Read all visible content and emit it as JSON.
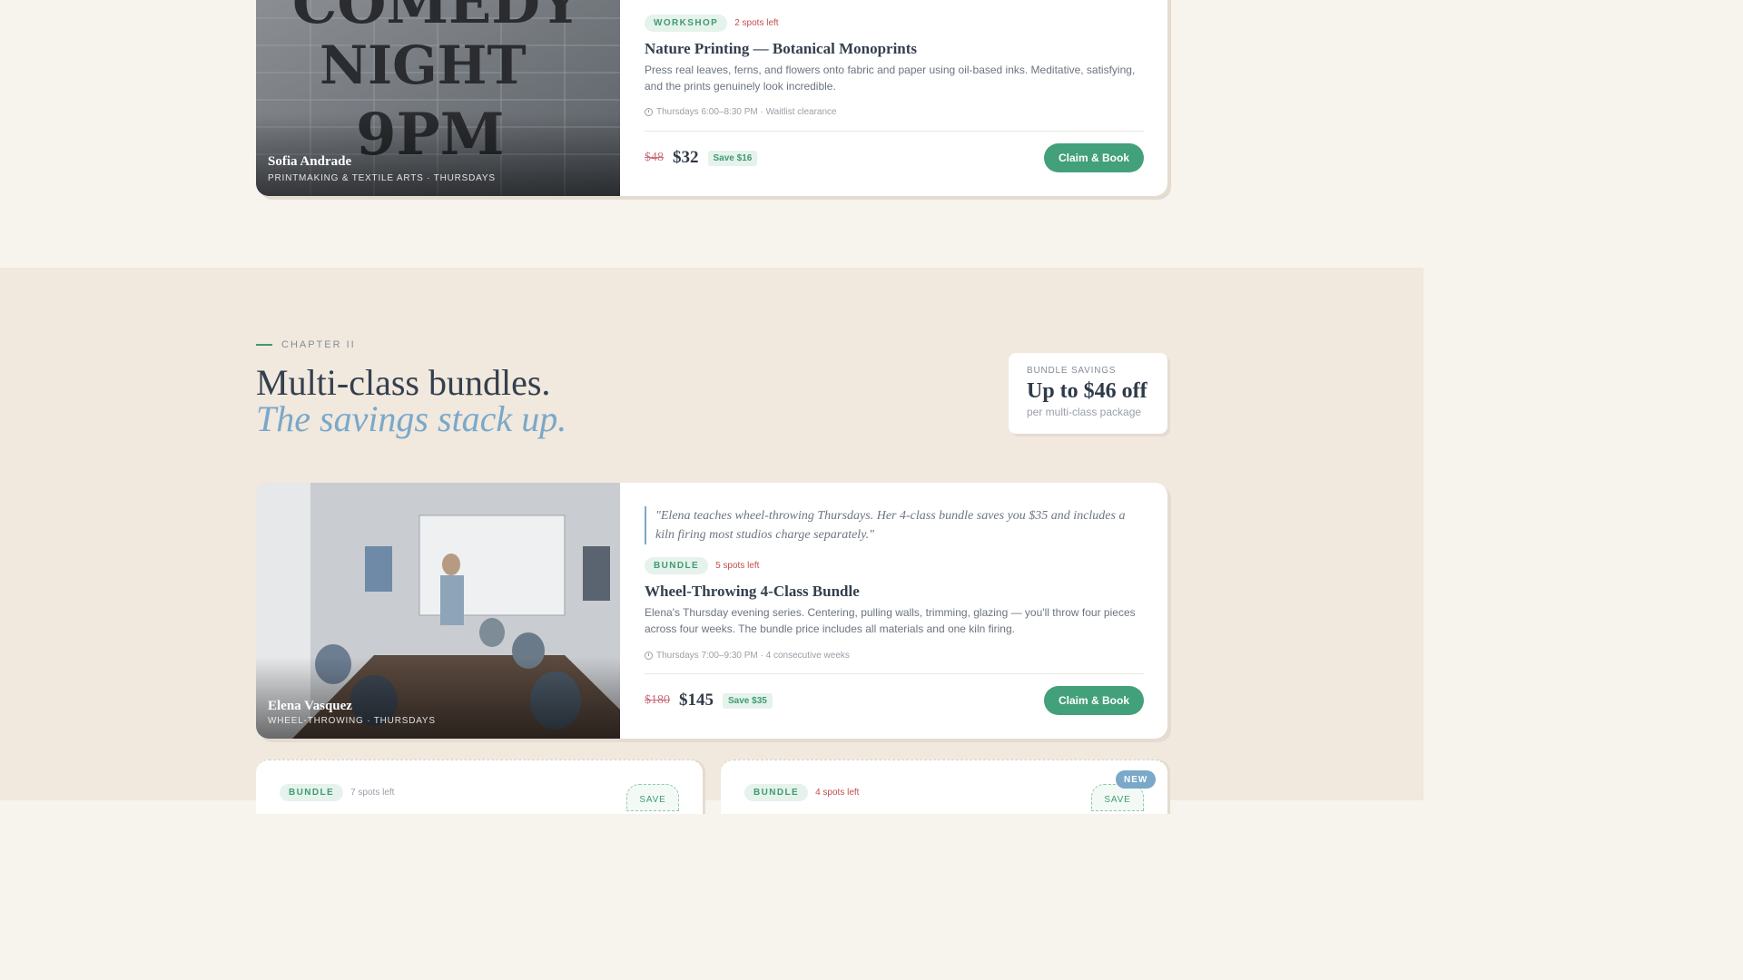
{
  "card1": {
    "instructor": {
      "name": "Sofia Andrade",
      "subtitle": "PRINTMAKING & TEXTILE ARTS · THURSDAYS"
    },
    "tag": "WORKSHOP",
    "spots": "2 spots left",
    "title": "Nature Printing — Botanical Monoprints",
    "description": "Press real leaves, ferns, and flowers onto fabric and paper using oil-based inks. Meditative, satisfying, and the prints genuinely look incredible.",
    "meta": "Thursdays 6:00–8:30 PM · Waitlist clearance",
    "old_price": "$48",
    "new_price": "$32",
    "save": "Save $16",
    "button": "Claim & Book",
    "photo_sign": {
      "line1": "COMEDY",
      "line2": "NIGHT",
      "line3": "9PM"
    }
  },
  "chapter": {
    "label": "CHAPTER II",
    "heading": "Multi-class bundles.",
    "subheading": "The savings stack up."
  },
  "savings": {
    "label": "BUNDLE SAVINGS",
    "value": "Up to $46 off",
    "note": "per multi-class package"
  },
  "card2": {
    "instructor": {
      "name": "Elena Vasquez",
      "subtitle": "WHEEL-THROWING · THURSDAYS"
    },
    "quote": "\"Elena teaches wheel-throwing Thursdays. Her 4-class bundle saves you $35 and includes a kiln firing most studios charge separately.\"",
    "tag": "BUNDLE",
    "spots": "5 spots left",
    "title": "Wheel-Throwing 4-Class Bundle",
    "description": "Elena's Thursday evening series. Centering, pulling walls, trimming, glazing — you'll throw four pieces across four weeks. The bundle price includes all materials and one kiln firing.",
    "meta": "Thursdays 7:00–9:30 PM · 4 consecutive weeks",
    "old_price": "$180",
    "new_price": "$145",
    "save": "Save $35",
    "button": "Claim & Book"
  },
  "mini1": {
    "tag": "BUNDLE",
    "spots": "7 spots left",
    "save": "SAVE"
  },
  "mini2": {
    "tag": "BUNDLE",
    "spots": "4 spots left",
    "save": "SAVE",
    "badge": "NEW"
  },
  "colors": {
    "accent_green": "#42a07a",
    "accent_blue": "#7aa8c9",
    "alert_red": "#c0504d"
  }
}
